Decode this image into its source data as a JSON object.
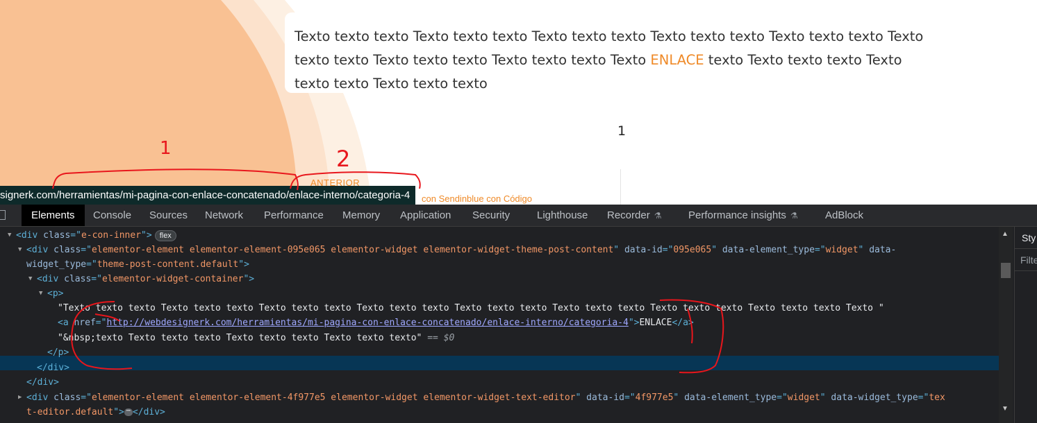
{
  "page": {
    "post_text_before": "Texto texto texto Texto texto texto Texto texto texto Texto texto texto Texto texto texto Texto texto texto Texto texto texto Texto texto texto Texto",
    "post_link": "ENLACE",
    "post_text_after": "texto Texto texto texto Texto texto texto Texto texto texto",
    "page_number": "1",
    "nav_prev_label": "ANTERIOR",
    "nav_next_title": "con Sendinblue con Código",
    "status_url": "signerk.com/herramientas/mi-pagina-con-enlace-concatenado/enlace-interno/categoria-4",
    "annotation_1": "1",
    "annotation_2": "2"
  },
  "devtools": {
    "tabs": [
      {
        "label": "Elements"
      },
      {
        "label": "Console"
      },
      {
        "label": "Sources"
      },
      {
        "label": "Network"
      },
      {
        "label": "Performance"
      },
      {
        "label": "Memory"
      },
      {
        "label": "Application"
      },
      {
        "label": "Security"
      },
      {
        "label": "Lighthouse"
      },
      {
        "label": "Recorder"
      },
      {
        "label": "Performance insights"
      },
      {
        "label": "AdBlock"
      }
    ],
    "flex_badge": "flex",
    "dom": {
      "l0": {
        "open": "<div ",
        "attr": "class",
        "eq": "=\"",
        "val": "e-con-inner",
        "close": "\">"
      },
      "l1": {
        "open": "<div ",
        "a1": "class",
        "v1": "elementor-element elementor-element-095e065 elementor-widget elementor-widget-theme-post-content",
        "a2": "data-id",
        "v2": "095e065",
        "a3": "data-element_type",
        "v3": "widget",
        "a4a": "data-",
        "a4b": "widget_type",
        "v4": "theme-post-content.default",
        "close": ">"
      },
      "l2": {
        "open": "<div ",
        "attr": "class",
        "val": "elementor-widget-container",
        "close": ">"
      },
      "l3": {
        "tag": "<p>"
      },
      "l4": {
        "text": "\"Texto texto texto Texto texto texto Texto texto texto Texto texto texto Texto texto texto Texto texto texto Texto texto texto Texto texto texto Texto \""
      },
      "l5": {
        "open": "<a ",
        "attr": "href",
        "href": "http://webdesignerk.com/herramientas/mi-pagina-con-enlace-concatenado/enlace-interno/categoria-4",
        "text": "ENLACE",
        "close": "</a>"
      },
      "l6": {
        "text": "\"&nbsp;texto Texto texto texto Texto texto texto Texto texto texto\"",
        "sel": "== $0"
      },
      "l7": {
        "tag": "</p>"
      },
      "l8": {
        "tag": "</div>"
      },
      "l9": {
        "tag": "</div>"
      },
      "l10": {
        "open": "<div ",
        "a1": "class",
        "v1": "elementor-element elementor-element-4f977e5 elementor-widget elementor-widget-text-editor",
        "a2": "data-id",
        "v2": "4f977e5",
        "a3": "data-element_type",
        "v3": "widget",
        "a4": "data-widget_type",
        "v4a": "tex",
        "v4b": "t-editor.default",
        "close": "</div>"
      }
    },
    "dots": "⋯",
    "styles_tab": "Sty",
    "filter_placeholder": "Filte"
  },
  "colors": {
    "link_orange": "#ef8a28",
    "peach_shape": "#f9c193",
    "selected_row": "#073655",
    "annotation_red": "#e8161c"
  }
}
